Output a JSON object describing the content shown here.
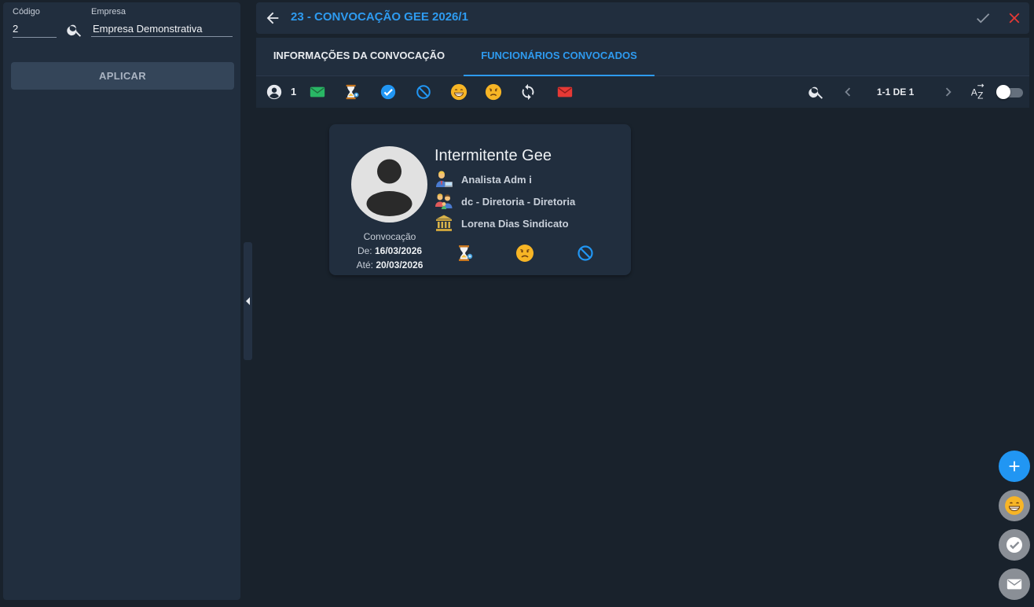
{
  "filters": {
    "codigo_label": "Código",
    "codigo_value": "2",
    "empresa_label": "Empresa",
    "empresa_value": "Empresa Demonstrativa",
    "apply_label": "APLICAR"
  },
  "header": {
    "title": "23 - CONVOCAÇÃO GEE 2026/1"
  },
  "tabs": [
    {
      "label": "INFORMAÇÕES DA CONVOCAÇÃO",
      "active": false
    },
    {
      "label": "FUNCIONÁRIOS CONVOCADOS",
      "active": true
    }
  ],
  "toolbar": {
    "count": "1",
    "pager": "1-1 DE 1",
    "icons": [
      "person-icon",
      "envelope-green-icon",
      "hourglass-icon",
      "check-circle-icon",
      "block-icon",
      "grin-emoji-icon",
      "sad-emoji-icon",
      "refresh-icon",
      "envelope-red-icon",
      "search-icon",
      "chevron-left-icon",
      "chevron-right-icon",
      "sort-az-icon",
      "toggle-switch"
    ]
  },
  "card": {
    "name": "Intermitente Gee",
    "role": "Analista Adm i",
    "department": "dc - Diretoria - Diretoria",
    "union": "Lorena Dias Sindicato",
    "convocacao_label": "Convocação",
    "de_label": "De:",
    "de_value": "16/03/2026",
    "ate_label": "Até:",
    "ate_value": "20/03/2026"
  },
  "colors": {
    "accent": "#2e9bf0",
    "danger": "#e53935",
    "success": "#29b765",
    "background": "#19222c",
    "panel": "#212e3e"
  }
}
